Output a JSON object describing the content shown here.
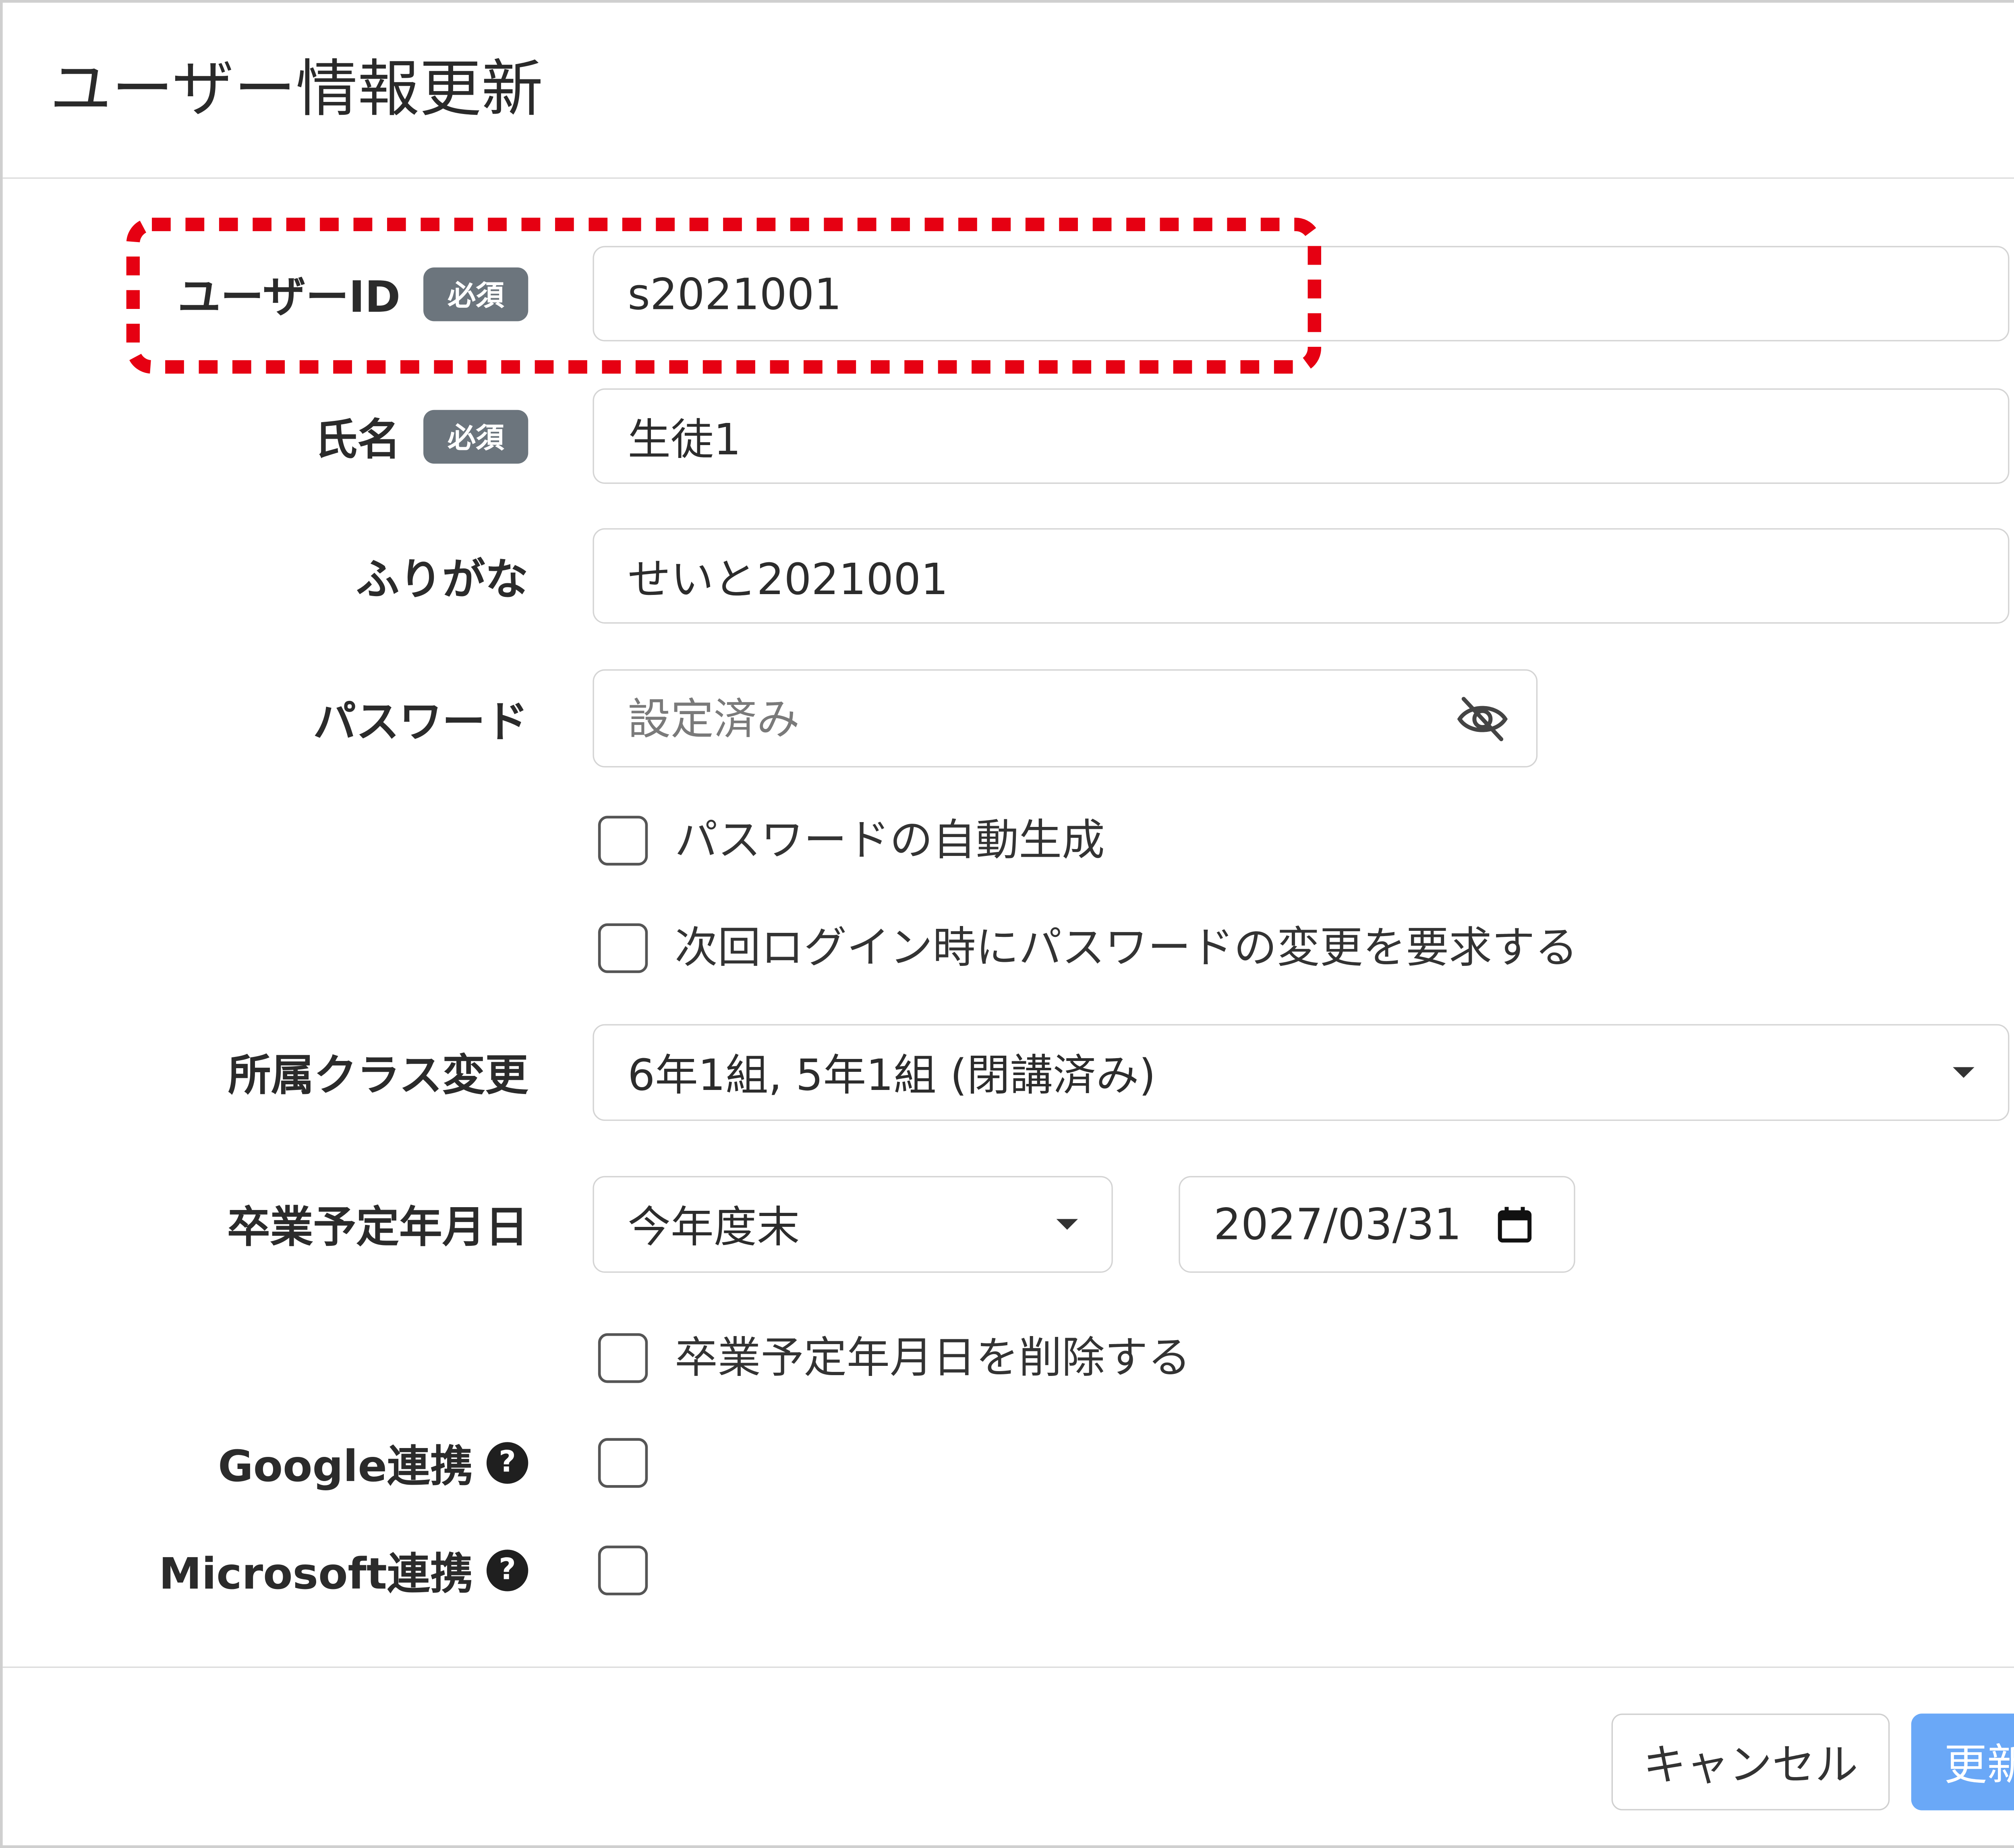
{
  "dialog": {
    "title": "ユーザー情報更新",
    "close_icon": "close-icon"
  },
  "form": {
    "required_badge": "必須",
    "user_id": {
      "label": "ユーザーID",
      "required": true,
      "value": "s2021001"
    },
    "name": {
      "label": "氏名",
      "required": true,
      "value": "生徒1"
    },
    "furigana": {
      "label": "ふりがな",
      "value": "せいと2021001"
    },
    "password": {
      "label": "パスワード",
      "placeholder": "設定済み",
      "visibility_icon": "eye-slash-icon"
    },
    "auto_generate_password": {
      "label": "パスワードの自動生成",
      "checked": false
    },
    "require_password_change": {
      "label": "次回ログイン時にパスワードの変更を要求する",
      "checked": false
    },
    "class_change": {
      "label": "所属クラス変更",
      "value": "6年1組, 5年1組 (閉講済み)",
      "icon": "chevron-down-icon"
    },
    "graduation_date": {
      "label": "卒業予定年月日",
      "preset": "今年度末",
      "preset_icon": "chevron-down-icon",
      "date": "2027/03/31",
      "calendar_icon": "calendar-icon"
    },
    "delete_graduation_date": {
      "label": "卒業予定年月日を削除する",
      "checked": false
    },
    "google_link": {
      "label": "Google連携",
      "help_icon": "question-circle-icon",
      "checked": false
    },
    "microsoft_link": {
      "label": "Microsoft連携",
      "help_icon": "question-circle-icon",
      "checked": false
    }
  },
  "footer": {
    "cancel_label": "キャンセル",
    "submit_label": "更新"
  },
  "colors": {
    "highlight": "#e60012",
    "primary_button": "#6aa8f7",
    "badge": "#6c757d"
  }
}
